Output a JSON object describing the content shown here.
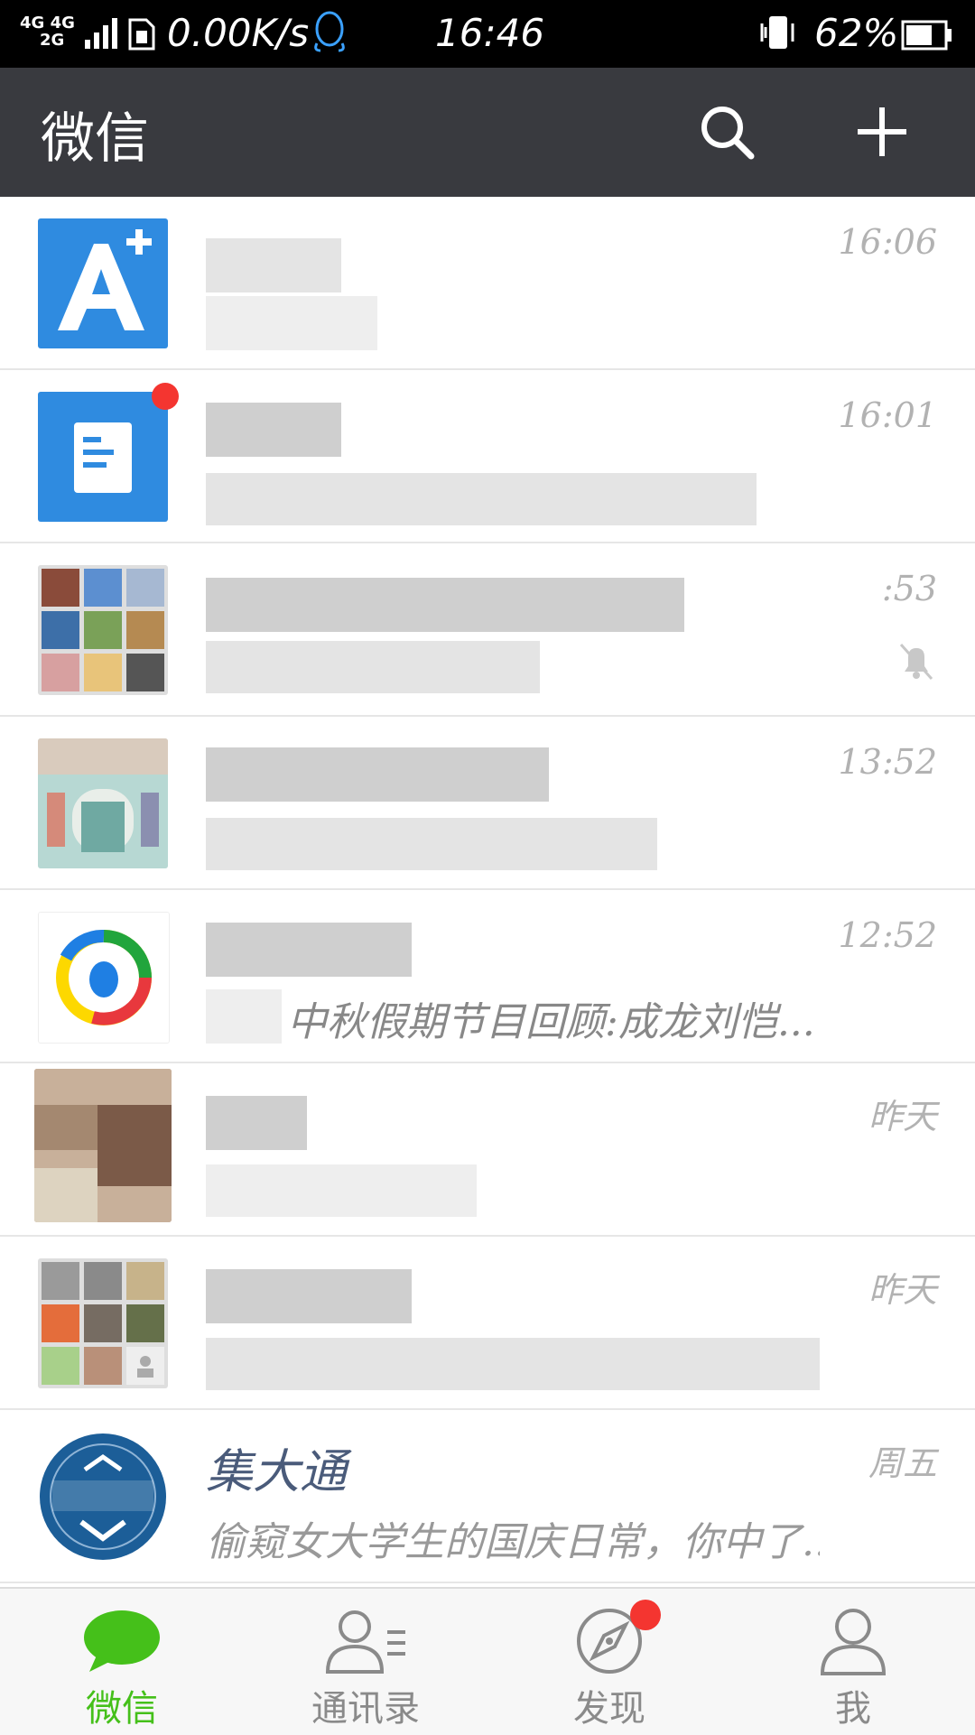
{
  "status_bar": {
    "network": "4G 4G",
    "network2": "2G",
    "speed": "0.00K/s",
    "time": "16:46",
    "battery": "62%"
  },
  "header": {
    "title": "微信"
  },
  "chats": [
    {
      "name": "",
      "message": "",
      "time": "16:06",
      "unread_dot": false,
      "muted": false,
      "avatar": "app-a-plus"
    },
    {
      "name": "",
      "message": "",
      "time": "16:01",
      "unread_dot": true,
      "muted": false,
      "avatar": "document-app"
    },
    {
      "name": "",
      "message": "",
      "time": ":53",
      "unread_dot": false,
      "muted": true,
      "avatar": "group-photos"
    },
    {
      "name": "",
      "message": "",
      "time": "13:52",
      "unread_dot": false,
      "muted": false,
      "avatar": "photo-storefront"
    },
    {
      "name": "",
      "message": "中秋假期节目回顾:成龙刘恺...",
      "time": "12:52",
      "unread_dot": false,
      "muted": false,
      "avatar": "tencent-news"
    },
    {
      "name": "",
      "message": "",
      "time": "昨天",
      "unread_dot": false,
      "muted": false,
      "avatar": "photo-person"
    },
    {
      "name": "",
      "message": "",
      "time": "昨天",
      "unread_dot": false,
      "muted": false,
      "avatar": "group-photos"
    },
    {
      "name": "集大通",
      "message": "偷窥女大学生的国庆日常，你中了...",
      "time": "周五",
      "unread_dot": false,
      "muted": false,
      "avatar": "jimutong-logo"
    }
  ],
  "tabs": [
    {
      "label": "微信",
      "icon": "chat-bubble-icon",
      "active": true
    },
    {
      "label": "通讯录",
      "icon": "contacts-icon",
      "active": false
    },
    {
      "label": "发现",
      "icon": "compass-icon",
      "active": false,
      "badge": true
    },
    {
      "label": "我",
      "icon": "person-icon",
      "active": false
    }
  ],
  "colors": {
    "header_bg": "#393a3f",
    "accent_green": "#45c01a",
    "badge_red": "#f43530"
  }
}
